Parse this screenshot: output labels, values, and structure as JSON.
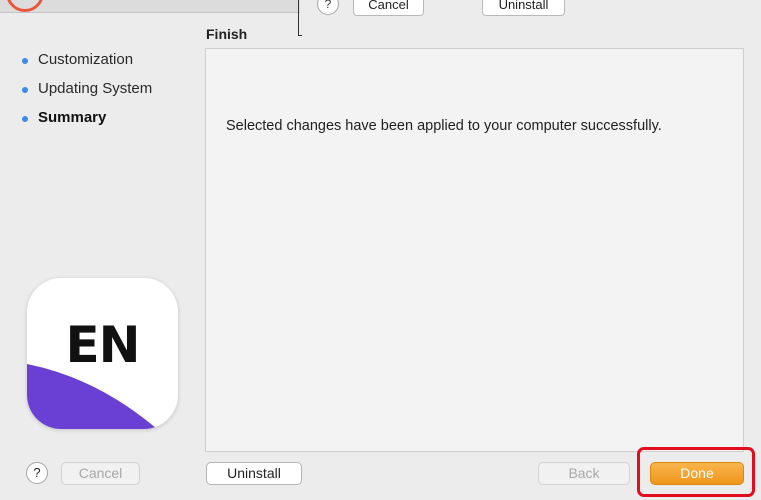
{
  "top": {
    "help_label": "?",
    "cancel_label": "Cancel",
    "uninstall_label": "Uninstall"
  },
  "sidebar": {
    "steps": [
      {
        "label": "Customization",
        "state": "done"
      },
      {
        "label": "Updating System",
        "state": "done"
      },
      {
        "label": "Summary",
        "state": "current"
      }
    ]
  },
  "app_icon": {
    "text": "EN",
    "accent_color": "#6a3fd4"
  },
  "main": {
    "section_title": "Finish",
    "message": "Selected changes have been applied to your computer successfully."
  },
  "footer": {
    "help_label": "?",
    "cancel_label": "Cancel",
    "uninstall_label": "Uninstall",
    "back_label": "Back",
    "done_label": "Done"
  },
  "colors": {
    "step_dot": "#3a8ae8",
    "primary_button": "#f0961b",
    "highlight": "#e20d1d"
  }
}
